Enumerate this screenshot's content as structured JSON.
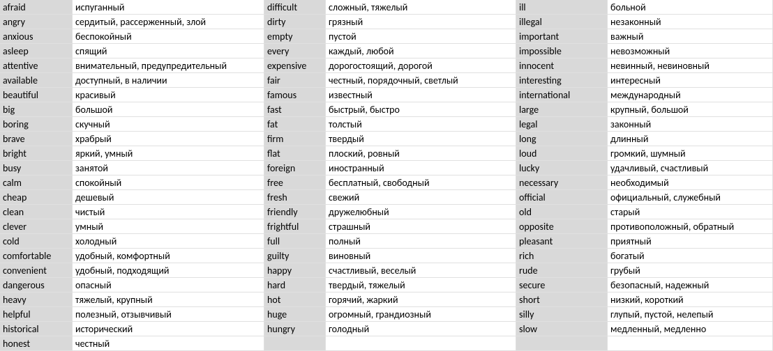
{
  "columns": [
    {
      "english": "afraid",
      "russian": "испуганный"
    },
    {
      "english": "angry",
      "russian": "сердитый, рассерженный, злой"
    },
    {
      "english": "anxious",
      "russian": "беспокойный"
    },
    {
      "english": "asleep",
      "russian": "спящий"
    },
    {
      "english": "attentive",
      "russian": "внимательный, предупредительный"
    },
    {
      "english": "available",
      "russian": "доступный, в наличии"
    },
    {
      "english": "beautiful",
      "russian": "красивый"
    },
    {
      "english": "big",
      "russian": "большой"
    },
    {
      "english": "boring",
      "russian": "скучный"
    },
    {
      "english": "brave",
      "russian": "храбрый"
    },
    {
      "english": "bright",
      "russian": "яркий, умный"
    },
    {
      "english": "busy",
      "russian": "занятой"
    },
    {
      "english": "calm",
      "russian": "спокойный"
    },
    {
      "english": "cheap",
      "russian": "дешевый"
    },
    {
      "english": "clean",
      "russian": "чистый"
    },
    {
      "english": "clever",
      "russian": "умный"
    },
    {
      "english": "cold",
      "russian": "холодный"
    },
    {
      "english": "comfortable",
      "russian": "удобный, комфортный"
    },
    {
      "english": "convenient",
      "russian": "удобный, подходящий"
    },
    {
      "english": "dangerous",
      "russian": "опасный"
    },
    {
      "english": "heavy",
      "russian": "тяжелый, крупный"
    },
    {
      "english": "helpful",
      "russian": "полезный, отзывчивый"
    },
    {
      "english": "historical",
      "russian": "исторический"
    },
    {
      "english": "honest",
      "russian": "честный"
    }
  ],
  "columns2": [
    {
      "english": "difficult",
      "russian": "сложный, тяжелый"
    },
    {
      "english": "dirty",
      "russian": "грязный"
    },
    {
      "english": "empty",
      "russian": "пустой"
    },
    {
      "english": "every",
      "russian": "каждый, любой"
    },
    {
      "english": "expensive",
      "russian": "дорогостоящий, дорогой"
    },
    {
      "english": "fair",
      "russian": "честный, порядочный, светлый"
    },
    {
      "english": "famous",
      "russian": "известный"
    },
    {
      "english": "fast",
      "russian": "быстрый, быстро"
    },
    {
      "english": "fat",
      "russian": "толстый"
    },
    {
      "english": "firm",
      "russian": "твердый"
    },
    {
      "english": "flat",
      "russian": "плоский, ровный"
    },
    {
      "english": "foreign",
      "russian": "иностранный"
    },
    {
      "english": "free",
      "russian": "бесплатный, свободный"
    },
    {
      "english": "fresh",
      "russian": "свежий"
    },
    {
      "english": "friendly",
      "russian": "дружелюбный"
    },
    {
      "english": "frightful",
      "russian": "страшный"
    },
    {
      "english": "full",
      "russian": "полный"
    },
    {
      "english": "guilty",
      "russian": "виновный"
    },
    {
      "english": "happy",
      "russian": "счастливый, веселый"
    },
    {
      "english": "hard",
      "russian": "твердый, тяжелый"
    },
    {
      "english": "hot",
      "russian": "горячий, жаркий"
    },
    {
      "english": "huge",
      "russian": "огромный, грандиозный"
    },
    {
      "english": "hungry",
      "russian": "голодный"
    },
    {
      "english": "",
      "russian": ""
    }
  ],
  "columns3": [
    {
      "english": "ill",
      "russian": "больной"
    },
    {
      "english": "illegal",
      "russian": "незаконный"
    },
    {
      "english": "important",
      "russian": "важный"
    },
    {
      "english": "impossible",
      "russian": "невозможный"
    },
    {
      "english": "innocent",
      "russian": "невинный, невиновный"
    },
    {
      "english": "interesting",
      "russian": "интересный"
    },
    {
      "english": "international",
      "russian": "международный"
    },
    {
      "english": "large",
      "russian": "крупный, большой"
    },
    {
      "english": "legal",
      "russian": "законный"
    },
    {
      "english": "long",
      "russian": "длинный"
    },
    {
      "english": "loud",
      "russian": "громкий, шумный"
    },
    {
      "english": "lucky",
      "russian": "удачливый, счастливый"
    },
    {
      "english": "necessary",
      "russian": "необходимый"
    },
    {
      "english": "official",
      "russian": "официальный, служебный"
    },
    {
      "english": "old",
      "russian": "старый"
    },
    {
      "english": "opposite",
      "russian": "противоположный, обратный"
    },
    {
      "english": "pleasant",
      "russian": "приятный"
    },
    {
      "english": "rich",
      "russian": "богатый"
    },
    {
      "english": "rude",
      "russian": "грубый"
    },
    {
      "english": "secure",
      "russian": "безопасный, надежный"
    },
    {
      "english": "short",
      "russian": "низкий, короткий"
    },
    {
      "english": "silly",
      "russian": "глупый, пустой, нелепый"
    },
    {
      "english": "slow",
      "russian": "медленный, медленно"
    },
    {
      "english": "",
      "russian": ""
    }
  ],
  "row_count": 24
}
